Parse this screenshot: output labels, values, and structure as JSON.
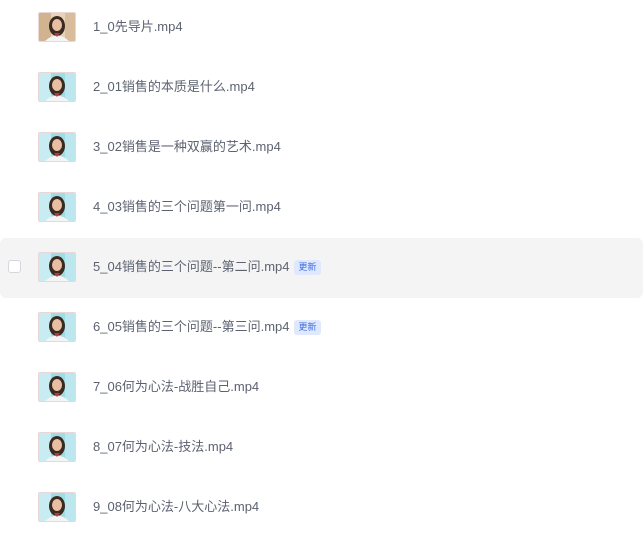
{
  "files": [
    {
      "name": "1_0先导片.mp4",
      "badge": "",
      "thumb": "warm"
    },
    {
      "name": "2_01销售的本质是什么.mp4",
      "badge": "",
      "thumb": "cyan"
    },
    {
      "name": "3_02销售是一种双赢的艺术.mp4",
      "badge": "",
      "thumb": "cyan"
    },
    {
      "name": "4_03销售的三个问题第一问.mp4",
      "badge": "",
      "thumb": "cyan"
    },
    {
      "name": "5_04销售的三个问题--第二问.mp4",
      "badge": "更新",
      "thumb": "cyan"
    },
    {
      "name": "6_05销售的三个问题--第三问.mp4",
      "badge": "更新",
      "thumb": "cyan"
    },
    {
      "name": "7_06何为心法-战胜自己.mp4",
      "badge": "",
      "thumb": "cyan"
    },
    {
      "name": "8_07何为心法-技法.mp4",
      "badge": "",
      "thumb": "cyan"
    },
    {
      "name": "9_08何为心法-八大心法.mp4",
      "badge": "",
      "thumb": "cyan"
    }
  ],
  "hovered_row": 4,
  "colors": {
    "text": "#5c6270",
    "badge_text": "#3e6fe0",
    "badge_bg": "#dfe8fd",
    "hover_bg": "#f4f4f5"
  }
}
